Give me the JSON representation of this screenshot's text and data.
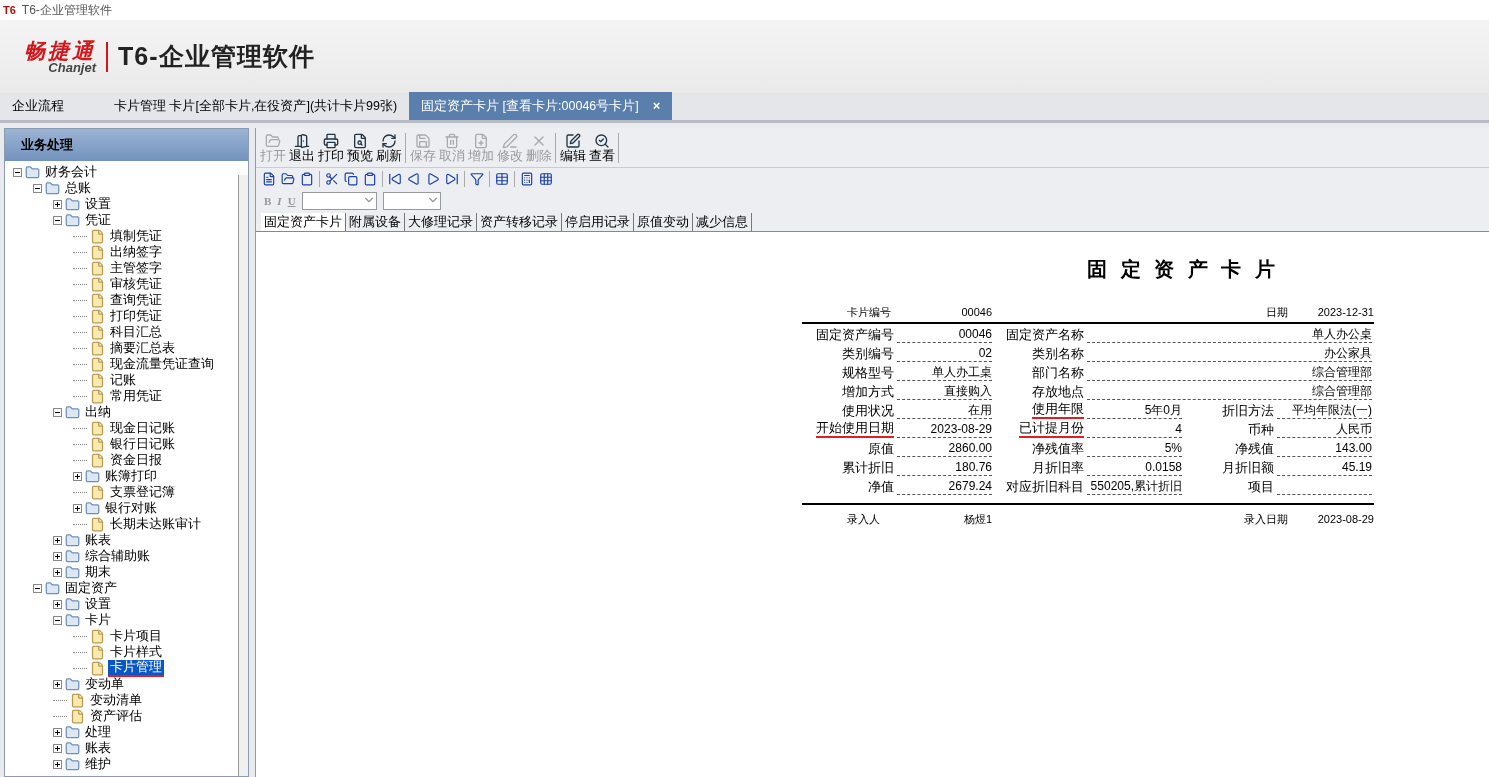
{
  "window": {
    "title": "T6-企业管理软件",
    "app_icon": "T6"
  },
  "banner": {
    "brand": "畅捷通",
    "brand_latin": "Chanjet",
    "product": "T6-企业管理软件"
  },
  "tabs": [
    {
      "label": "企业流程",
      "selected": false
    },
    {
      "label": "卡片管理 卡片[全部卡片,在役资产](共计卡片99张)",
      "selected": false
    },
    {
      "label": "固定资产卡片 [查看卡片:00046号卡片]",
      "selected": true,
      "close": "×"
    }
  ],
  "sidebar": {
    "title": "业务处理",
    "tree": [
      {
        "kind": "folder",
        "label": "财务会计",
        "expanded": true,
        "children": [
          {
            "kind": "folder",
            "label": "总账",
            "expanded": true,
            "children": [
              {
                "kind": "folder",
                "label": "设置",
                "expanded": false
              },
              {
                "kind": "folder",
                "label": "凭证",
                "expanded": true,
                "children": [
                  {
                    "kind": "leaf",
                    "label": "填制凭证",
                    "selected": false
                  },
                  {
                    "kind": "leaf",
                    "label": "出纳签字",
                    "selected": false
                  },
                  {
                    "kind": "leaf",
                    "label": "主管签字",
                    "selected": false
                  },
                  {
                    "kind": "leaf",
                    "label": "审核凭证",
                    "selected": false
                  },
                  {
                    "kind": "leaf",
                    "label": "查询凭证",
                    "selected": false
                  },
                  {
                    "kind": "leaf",
                    "label": "打印凭证",
                    "selected": false
                  },
                  {
                    "kind": "leaf",
                    "label": "科目汇总",
                    "selected": false
                  },
                  {
                    "kind": "leaf",
                    "label": "摘要汇总表",
                    "selected": false
                  },
                  {
                    "kind": "leaf",
                    "label": "现金流量凭证查询",
                    "selected": false
                  },
                  {
                    "kind": "leaf",
                    "label": "记账",
                    "selected": false
                  },
                  {
                    "kind": "leaf",
                    "label": "常用凭证",
                    "selected": false
                  }
                ]
              },
              {
                "kind": "folder",
                "label": "出纳",
                "expanded": true,
                "children": [
                  {
                    "kind": "leaf",
                    "label": "现金日记账",
                    "selected": false
                  },
                  {
                    "kind": "leaf",
                    "label": "银行日记账",
                    "selected": false
                  },
                  {
                    "kind": "leaf",
                    "label": "资金日报",
                    "selected": false
                  },
                  {
                    "kind": "folder",
                    "label": "账簿打印",
                    "expanded": false
                  },
                  {
                    "kind": "leaf",
                    "label": "支票登记簿",
                    "selected": false
                  },
                  {
                    "kind": "folder",
                    "label": "银行对账",
                    "expanded": false
                  },
                  {
                    "kind": "leaf",
                    "label": "长期未达账审计",
                    "selected": false
                  }
                ]
              },
              {
                "kind": "folder",
                "label": "账表",
                "expanded": false
              },
              {
                "kind": "folder",
                "label": "综合辅助账",
                "expanded": false
              },
              {
                "kind": "folder",
                "label": "期末",
                "expanded": false
              }
            ]
          },
          {
            "kind": "folder",
            "label": "固定资产",
            "expanded": true,
            "children": [
              {
                "kind": "folder",
                "label": "设置",
                "expanded": false
              },
              {
                "kind": "folder",
                "label": "卡片",
                "expanded": true,
                "children": [
                  {
                    "kind": "leaf",
                    "label": "卡片项目",
                    "selected": false
                  },
                  {
                    "kind": "leaf",
                    "label": "卡片样式",
                    "selected": false
                  },
                  {
                    "kind": "leaf",
                    "label": "卡片管理",
                    "selected": true,
                    "underlined": true
                  }
                ]
              },
              {
                "kind": "folder",
                "label": "变动单",
                "expanded": false
              },
              {
                "kind": "leaf",
                "label": "变动清单",
                "selected": false
              },
              {
                "kind": "leaf",
                "label": "资产评估",
                "selected": false
              },
              {
                "kind": "folder",
                "label": "处理",
                "expanded": false
              },
              {
                "kind": "folder",
                "label": "账表",
                "expanded": false
              },
              {
                "kind": "folder",
                "label": "维护",
                "expanded": false
              }
            ]
          }
        ]
      }
    ]
  },
  "toolbar": [
    {
      "kind": "open",
      "label": "打开",
      "disabled": true
    },
    {
      "kind": "exit",
      "label": "退出",
      "disabled": false
    },
    {
      "kind": "print",
      "label": "打印",
      "disabled": false
    },
    {
      "kind": "preview",
      "label": "预览",
      "disabled": false
    },
    {
      "kind": "refresh",
      "label": "刷新",
      "disabled": false
    },
    {
      "kind": "save",
      "label": "保存",
      "disabled": true
    },
    {
      "kind": "cancel",
      "label": "取消",
      "disabled": true
    },
    {
      "kind": "add",
      "label": "增加",
      "disabled": true
    },
    {
      "kind": "edit",
      "label": "修改",
      "disabled": true
    },
    {
      "kind": "delete",
      "label": "删除",
      "disabled": true
    },
    {
      "kind": "compose",
      "label": "编辑",
      "disabled": false
    },
    {
      "kind": "view",
      "label": "查看",
      "disabled": false
    }
  ],
  "format_bar": {
    "bold": "B",
    "italic": "I",
    "underline": "U"
  },
  "subtabs": [
    {
      "label": "固定资产卡片",
      "selected": true
    },
    {
      "label": "附属设备",
      "selected": false
    },
    {
      "label": "大修理记录",
      "selected": false
    },
    {
      "label": "资产转移记录",
      "selected": false
    },
    {
      "label": "停启用记录",
      "selected": false
    },
    {
      "label": "原值变动",
      "selected": false
    },
    {
      "label": "减少信息",
      "selected": false
    }
  ],
  "card": {
    "title": "固 定 资 产 卡 片",
    "header": [
      {
        "label": "卡片编号",
        "value": "00046"
      },
      {
        "label": "日期",
        "value": "2023-12-31"
      }
    ],
    "rows": [
      [
        {
          "label": "固定资产编号",
          "value": "00046",
          "underlined": false
        },
        {
          "label": "固定资产名称",
          "value": "单人办公桌",
          "underlined": false
        }
      ],
      [
        {
          "label": "类别编号",
          "value": "02",
          "underlined": false
        },
        {
          "label": "类别名称",
          "value": "办公家具",
          "underlined": false
        }
      ],
      [
        {
          "label": "规格型号",
          "value": "单人办工桌",
          "underlined": false
        },
        {
          "label": "部门名称",
          "value": "综合管理部",
          "underlined": false
        }
      ],
      [
        {
          "label": "增加方式",
          "value": "直接购入",
          "underlined": false
        },
        {
          "label": "存放地点",
          "value": "综合管理部",
          "underlined": false
        }
      ],
      [
        {
          "label": "使用状况",
          "value": "在用",
          "underlined": false
        },
        {
          "label": "使用年限",
          "value": "5年0月",
          "underlined": true
        },
        {
          "label": "折旧方法",
          "value": "平均年限法(一)",
          "underlined": false
        }
      ],
      [
        {
          "label": "开始使用日期",
          "value": "2023-08-29",
          "underlined": true
        },
        {
          "label": "已计提月份",
          "value": "4",
          "underlined": true
        },
        {
          "label": "币种",
          "value": "人民币",
          "underlined": false
        }
      ],
      [
        {
          "label": "原值",
          "value": "2860.00",
          "underlined": false
        },
        {
          "label": "净残值率",
          "value": "5%",
          "underlined": false
        },
        {
          "label": "净残值",
          "value": "143.00",
          "underlined": false
        }
      ],
      [
        {
          "label": "累计折旧",
          "value": "180.76",
          "underlined": false
        },
        {
          "label": "月折旧率",
          "value": "0.0158",
          "underlined": false
        },
        {
          "label": "月折旧额",
          "value": "45.19",
          "underlined": false
        }
      ],
      [
        {
          "label": "净值",
          "value": "2679.24",
          "underlined": false
        },
        {
          "label": "对应折旧科目",
          "value": "550205,累计折旧",
          "underlined": false
        },
        {
          "label": "项目",
          "underlined": false
        }
      ]
    ],
    "footer": [
      {
        "label": "录入人",
        "value": "杨煜1"
      },
      {
        "label": "录入日期",
        "value": "2023-08-29"
      }
    ]
  }
}
